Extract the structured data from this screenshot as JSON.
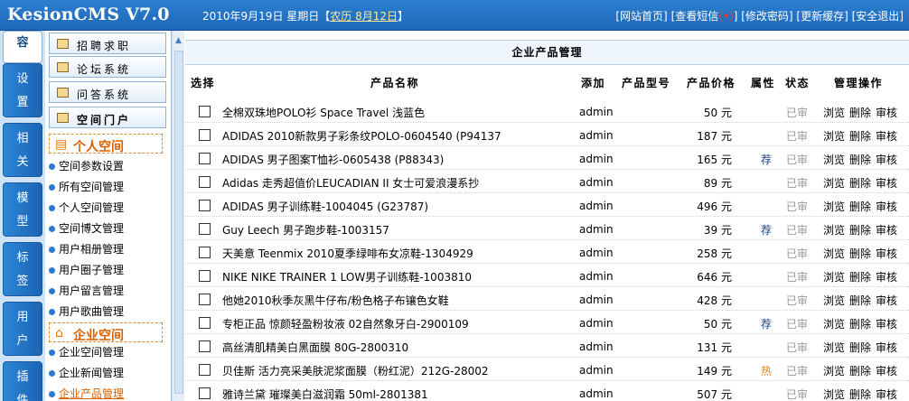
{
  "app": {
    "logo": "KesionCMS V7.0",
    "date_text": "2010年9月19日 星期日【",
    "lunar": "农历 8月12日",
    "date_close": "】"
  },
  "top_links": [
    "[网站首页]",
    "[查看短信",
    "]",
    "[修改密码]",
    "[更新缓存]",
    "[安全退出]"
  ],
  "top_unread_dot": "(•)",
  "vertical_tabs": [
    "容",
    "设\n置",
    "相\n关",
    "模\n型",
    "标\n签",
    "用\n户",
    "插\n件"
  ],
  "menu": {
    "buttons": [
      "招聘求职",
      "论坛系统",
      "问答系统",
      "空间门户"
    ],
    "personal_header": "个人空间",
    "personal_items": [
      "空间参数设置",
      "所有空间管理",
      "个人空间管理",
      "空间博文管理",
      "用户相册管理",
      "用户圈子管理",
      "用户留言管理",
      "用户歌曲管理"
    ],
    "enterprise_header": "企业空间",
    "enterprise_items": [
      "企业空间管理",
      "企业新闻管理",
      "企业产品管理"
    ]
  },
  "main": {
    "title": "企业产品管理",
    "headers": {
      "select": "选择",
      "name": "产品名称",
      "adder": "添加",
      "model": "产品型号",
      "price": "产品价格",
      "attr": "属性",
      "status": "状态",
      "ops": "管理操作"
    },
    "rows": [
      {
        "name": "全棉双珠地POLO衫 Space Travel 浅蓝色",
        "adder": "admin",
        "price": "50 元",
        "attr": "",
        "status": "已审",
        "ops": [
          "浏览",
          "删除",
          "审核"
        ]
      },
      {
        "name": "ADIDAS 2010新款男子彩条纹POLO-0604540 (P94137",
        "adder": "admin",
        "price": "187 元",
        "attr": "",
        "status": "已审",
        "ops": [
          "浏览",
          "删除",
          "审核"
        ]
      },
      {
        "name": "ADIDAS 男子图案T恤衫-0605438 (P88343)",
        "adder": "admin",
        "price": "165 元",
        "attr": "荐",
        "status": "已审",
        "ops": [
          "浏览",
          "删除",
          "审核"
        ]
      },
      {
        "name": "Adidas 走秀超值价LEUCADIAN II 女士可爱浪漫系抄",
        "adder": "admin",
        "price": "89 元",
        "attr": "",
        "status": "已审",
        "ops": [
          "浏览",
          "删除",
          "审核"
        ]
      },
      {
        "name": "ADIDAS 男子训练鞋-1004045 (G23787)",
        "adder": "admin",
        "price": "496 元",
        "attr": "",
        "status": "已审",
        "ops": [
          "浏览",
          "删除",
          "审核"
        ]
      },
      {
        "name": "Guy Leech 男子跑步鞋-1003157",
        "adder": "admin",
        "price": "39 元",
        "attr": "荐",
        "status": "已审",
        "ops": [
          "浏览",
          "删除",
          "审核"
        ]
      },
      {
        "name": "天美意 Teenmix 2010夏季绿啡布女凉鞋-1304929",
        "adder": "admin",
        "price": "258 元",
        "attr": "",
        "status": "已审",
        "ops": [
          "浏览",
          "删除",
          "审核"
        ]
      },
      {
        "name": "NIKE NIKE TRAINER 1 LOW男子训练鞋-1003810",
        "adder": "admin",
        "price": "646 元",
        "attr": "",
        "status": "已审",
        "ops": [
          "浏览",
          "删除",
          "审核"
        ]
      },
      {
        "name": "他她2010秋季灰黑牛仔布/粉色格子布镶色女鞋",
        "adder": "admin",
        "price": "428 元",
        "attr": "",
        "status": "已审",
        "ops": [
          "浏览",
          "删除",
          "审核"
        ]
      },
      {
        "name": "专柜正品 惊颜轻盈粉妆液 02自然象牙白-2900109",
        "adder": "admin",
        "price": "50 元",
        "attr": "荐",
        "status": "已审",
        "ops": [
          "浏览",
          "删除",
          "审核"
        ]
      },
      {
        "name": "高丝清肌精美白黑面膜 80G-2800310",
        "adder": "admin",
        "price": "131 元",
        "attr": "",
        "status": "已审",
        "ops": [
          "浏览",
          "删除",
          "审核"
        ]
      },
      {
        "name": "贝佳斯 活力亮采美肤泥浆面膜（粉红泥）212G-28002",
        "adder": "admin",
        "price": "149 元",
        "attr": "热",
        "status": "已审",
        "ops": [
          "浏览",
          "删除",
          "审核"
        ]
      },
      {
        "name": "雅诗兰黛 璀璨美白滋润霜 50ml-2801381",
        "adder": "admin",
        "price": "507 元",
        "attr": "",
        "status": "已审",
        "ops": [
          "浏览",
          "删除",
          "审核"
        ]
      }
    ]
  }
}
